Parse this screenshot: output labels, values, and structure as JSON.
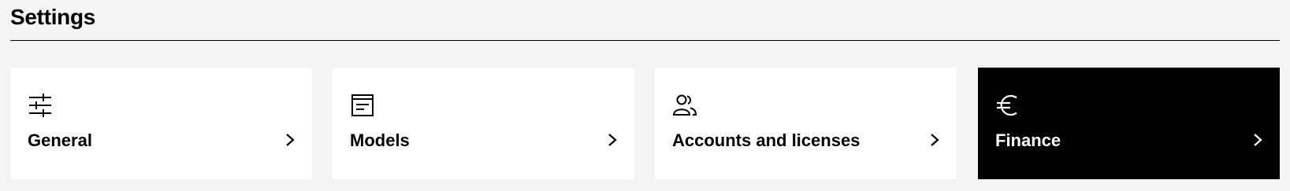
{
  "header": {
    "title": "Settings"
  },
  "cards": [
    {
      "label": "General",
      "icon": "sliders-icon",
      "active": false
    },
    {
      "label": "Models",
      "icon": "document-window-icon",
      "active": false
    },
    {
      "label": "Accounts and licenses",
      "icon": "users-icon",
      "active": false
    },
    {
      "label": "Finance",
      "icon": "euro-icon",
      "active": true
    }
  ],
  "colors": {
    "page_background": "#f4f4f6",
    "card_background": "#ffffff",
    "active_card_background": "#000000",
    "text": "#000000",
    "active_text": "#ffffff"
  }
}
